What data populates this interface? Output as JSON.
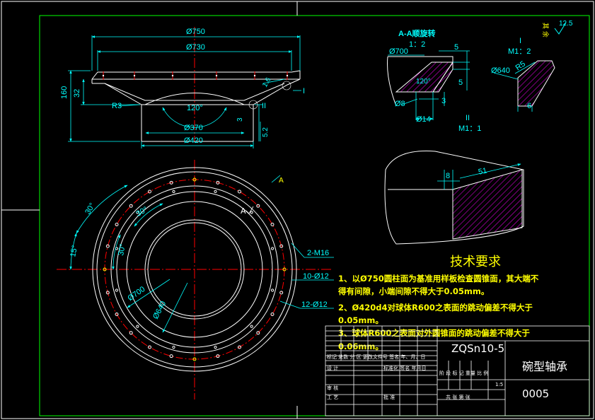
{
  "section_view": {
    "dims": {
      "d750": "Ø750",
      "d730": "Ø730",
      "d370": "Ø370",
      "d420": "Ø420",
      "h160": "160",
      "h32": "32",
      "r3": "R3",
      "angle120": "120°",
      "t3": "3",
      "t5_2": "5.2",
      "t1": "1.6"
    },
    "callouts": {
      "I": "I",
      "II": "II"
    }
  },
  "detail_aa": {
    "title": "A-A顺旋转",
    "scale": "1：2",
    "dims": {
      "d700": "Ø700",
      "d120": "120°",
      "d8": "Ø8",
      "d14": "Ø14",
      "n5a": "5",
      "n5b": "5",
      "n3": "3"
    }
  },
  "detail_I": {
    "title": "I",
    "scale": "M1：2",
    "dims": {
      "d640": "Ø640",
      "r5": "R5",
      "n6": "6"
    }
  },
  "detail_II": {
    "title": "II",
    "scale": "M1：1",
    "dims": {
      "n8": "8",
      "n51": "51"
    }
  },
  "plan_view": {
    "dims": {
      "a30a": "30°",
      "a30b": "30°",
      "a30c": "30°",
      "a15": "15°",
      "d700": "Ø700",
      "d640": "Ø640",
      "h2m16": "2-M16",
      "h10": "10-Ø12",
      "h12": "12-Ø12",
      "secA1": "A",
      "secA2": "A"
    }
  },
  "roughness": {
    "label": "其 余",
    "value": "12.5"
  },
  "tech_req": {
    "title": "技术要求",
    "lines": [
      "1、以Ø750圆柱面为基准用样板检查圆锥面，其大端不",
      "得有间隙，小端间隙不得大于0.05mm。",
      "2、Ø420d4对球体R600之表面的跳动偏差不得大于",
      "0.05mm。",
      "3、球体R600之表面对外圆锥面的跳动偏差不得大于",
      "0.06mm。"
    ]
  },
  "title_block": {
    "material": "ZQSn10-5",
    "part_name": "碗型轴承",
    "drawing_no": "0005",
    "scale": "1:5",
    "rev_header": "标记 处数  分  区 更改文件号 签名  年、月、日",
    "design": "设  计",
    "std": "标准化 签名 年月日",
    "stage_header": "阶  段  标  记   重量  比 例",
    "check": "审  核",
    "process": "工  艺",
    "approve": "批  准",
    "sheets": "共      张      第      张"
  },
  "colors": {
    "frame": "#ffffff",
    "border": "#00ff00",
    "dimension": "#00ffff",
    "center": "#ff0000",
    "hatch": "#ff00ff",
    "text_note": "#ffff00"
  }
}
